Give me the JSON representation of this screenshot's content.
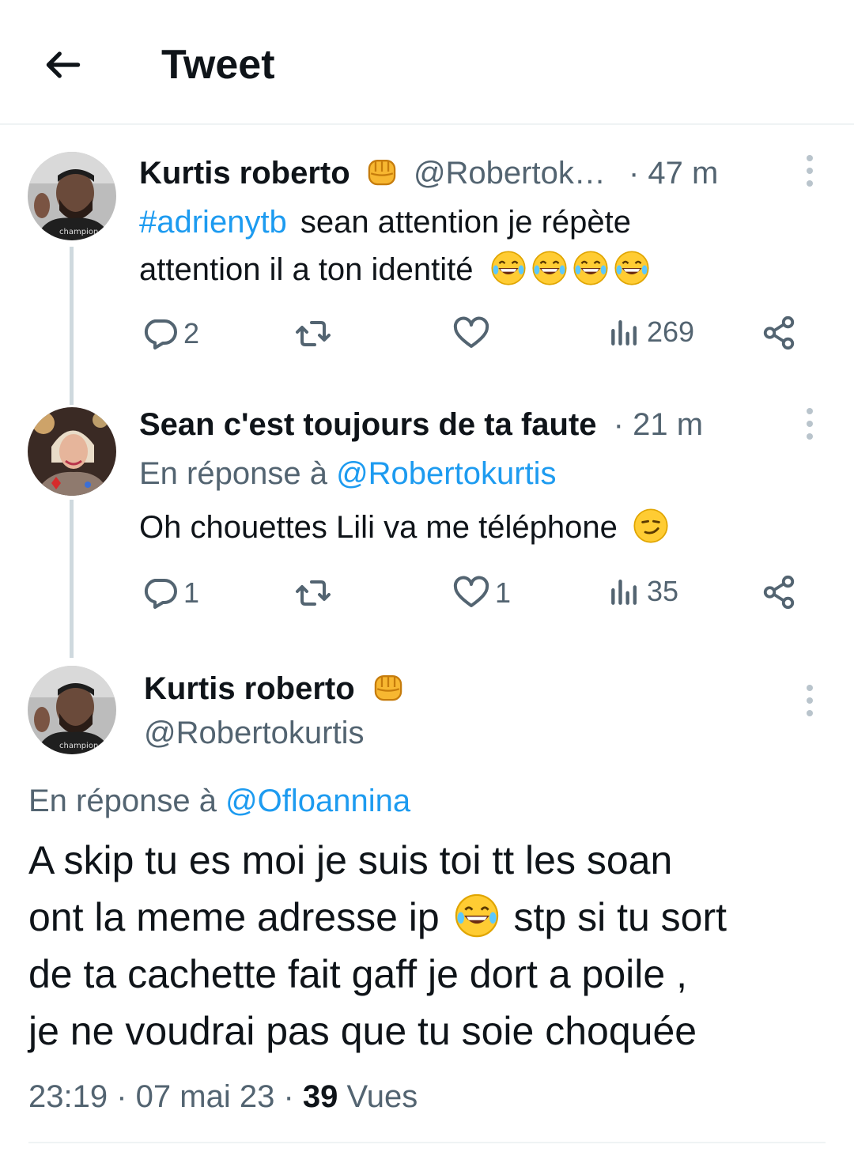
{
  "header": {
    "title": "Tweet"
  },
  "tweets": [
    {
      "display_name": "Kurtis roberto",
      "handle": "@Robertok…",
      "time": "· 47 m",
      "hashtag": "#adrienytb",
      "text_1": " sean attention je répète",
      "text_2": "attention il a ton identité",
      "reply_count": "2",
      "retweet_count": "",
      "like_count": "",
      "views_count": "269"
    },
    {
      "display_name": "Sean c'est toujours de ta faute",
      "time": "· 21 m",
      "reply_prefix": "En réponse à ",
      "reply_to": "@Robertokurtis",
      "text_1": "Oh chouettes Lili va me téléphone",
      "reply_count": "1",
      "retweet_count": "",
      "like_count": "1",
      "views_count": "35"
    }
  ],
  "main_tweet": {
    "display_name": "Kurtis roberto",
    "handle": "@Robertokurtis",
    "reply_prefix": "En réponse à ",
    "reply_to": "@Ofloannina",
    "line_1": "A skip tu es moi je suis toi tt les soan",
    "line_2a": "ont la meme adresse ip ",
    "line_2b": " stp si tu sort",
    "line_3": "de ta cachette fait gaff je dort a poile ,",
    "line_4": "je ne voudrai pas que tu soie choquée",
    "time": "23:19",
    "date": "07 mai 23",
    "views_number": "39",
    "views_label": "Vues",
    "separator": " · "
  },
  "colors": {
    "accent": "#1d9bf0",
    "muted": "#536471",
    "text": "#0f1419",
    "thread_line": "#cfd9de"
  },
  "icons": [
    "back-arrow-icon",
    "fist-emoji-icon",
    "laughing-tears-emoji-icon",
    "smirk-emoji-icon",
    "reply-icon",
    "retweet-icon",
    "like-icon",
    "views-icon",
    "share-icon",
    "more-icon"
  ]
}
